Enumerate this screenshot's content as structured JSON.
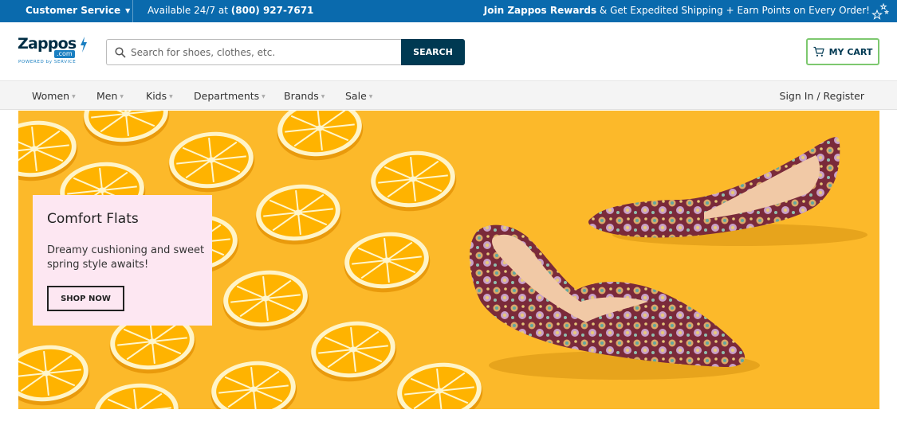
{
  "topbar": {
    "customer_service": "Customer Service",
    "availability_prefix": "Available 24/7 at ",
    "phone": "(800) 927-7671",
    "rewards_bold": "Join Zappos Rewards",
    "rewards_rest": " & Get Expedited Shipping + Earn Points on Every Order!"
  },
  "header": {
    "logo": {
      "name": "Zappos",
      "domain": ".com",
      "tagline": "POWERED by SERVICE"
    },
    "search": {
      "placeholder": "Search for shoes, clothes, etc.",
      "value": "",
      "button_label": "SEARCH"
    },
    "cart_label": "MY CART"
  },
  "nav": {
    "items": [
      {
        "label": "Women"
      },
      {
        "label": "Men"
      },
      {
        "label": "Kids"
      },
      {
        "label": "Departments"
      },
      {
        "label": "Brands"
      },
      {
        "label": "Sale"
      }
    ],
    "sign_in": "Sign In / Register"
  },
  "hero": {
    "title": "Comfort Flats",
    "description": "Dreamy cushioning and sweet spring style awaits!",
    "cta_label": "SHOP NOW",
    "background_color": "#fcb92a",
    "card_color": "#fde7f2"
  },
  "colors": {
    "topbar": "#0a6aad",
    "search_button": "#003952",
    "cart_border": "#7dc86f",
    "nav_background": "#f4f4f4"
  },
  "icons": [
    "chevron-down-icon",
    "stars-icon",
    "search-icon",
    "cart-icon",
    "zappos-logo"
  ]
}
